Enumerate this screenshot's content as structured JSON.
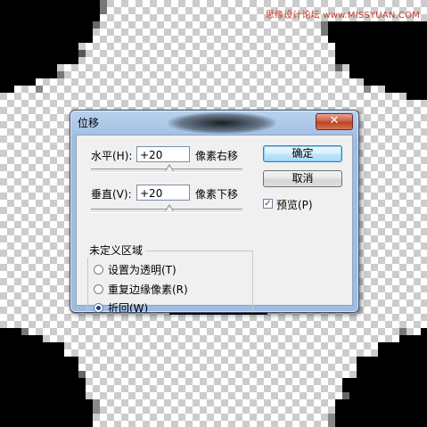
{
  "watermark": "思缘设计论坛 www.MISSYUAN.COM",
  "dialog": {
    "title": "位移",
    "close_label": "✕",
    "horizontal": {
      "label": "水平(H):",
      "value": "+20",
      "unit": "像素右移",
      "slider_fraction": 0.52
    },
    "vertical": {
      "label": "垂直(V):",
      "value": "+20",
      "unit": "像素下移",
      "slider_fraction": 0.52
    },
    "buttons": {
      "ok": "确定",
      "cancel": "取消"
    },
    "preview": {
      "label": "预览(P)",
      "checked": true,
      "check_mark": "✓"
    },
    "undefined_area": {
      "title": "未定义区域",
      "options": [
        {
          "label": "设置为透明(T)",
          "checked": false
        },
        {
          "label": "重复边缘像素(R)",
          "checked": false
        },
        {
          "label": "折回(W)",
          "checked": true
        }
      ]
    }
  },
  "colors": {
    "dialog_frame": "#a9c5e6",
    "close_button": "#c75a40",
    "default_button_border": "#3c7fb1",
    "canvas_black": "#000000"
  }
}
